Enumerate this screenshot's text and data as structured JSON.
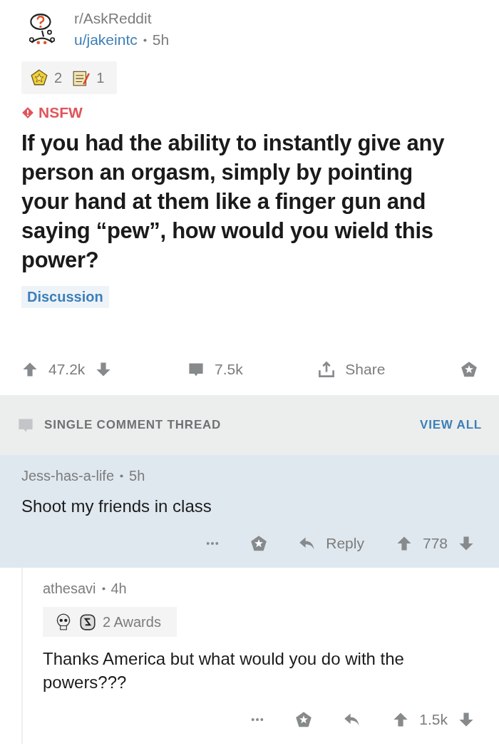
{
  "post": {
    "subreddit": "r/AskReddit",
    "author": "u/jakeintc",
    "time": "5h",
    "awards": [
      {
        "kind": "star",
        "count": "2"
      },
      {
        "kind": "notepad",
        "count": "1"
      }
    ],
    "nsfw_label": "NSFW",
    "title": "If you had the ability to instantly give any person an orgasm, simply by pointing your hand at them like a finger gun and saying “pew”, how would you wield this power?",
    "flair": "Discussion",
    "score": "47.2k",
    "comments": "7.5k",
    "share": "Share"
  },
  "thread": {
    "label": "SINGLE COMMENT THREAD",
    "view_all": "VIEW ALL"
  },
  "comments": [
    {
      "author": "Jess-has-a-life",
      "time": "5h",
      "highlighted": true,
      "body": "Shoot my friends in class",
      "reply": "Reply",
      "score": "778"
    },
    {
      "author": "athesavi",
      "time": "4h",
      "highlighted": false,
      "awards_label": "2 Awards",
      "body": "Thanks America but what would you do with the powers???",
      "score": "1.5k"
    }
  ]
}
